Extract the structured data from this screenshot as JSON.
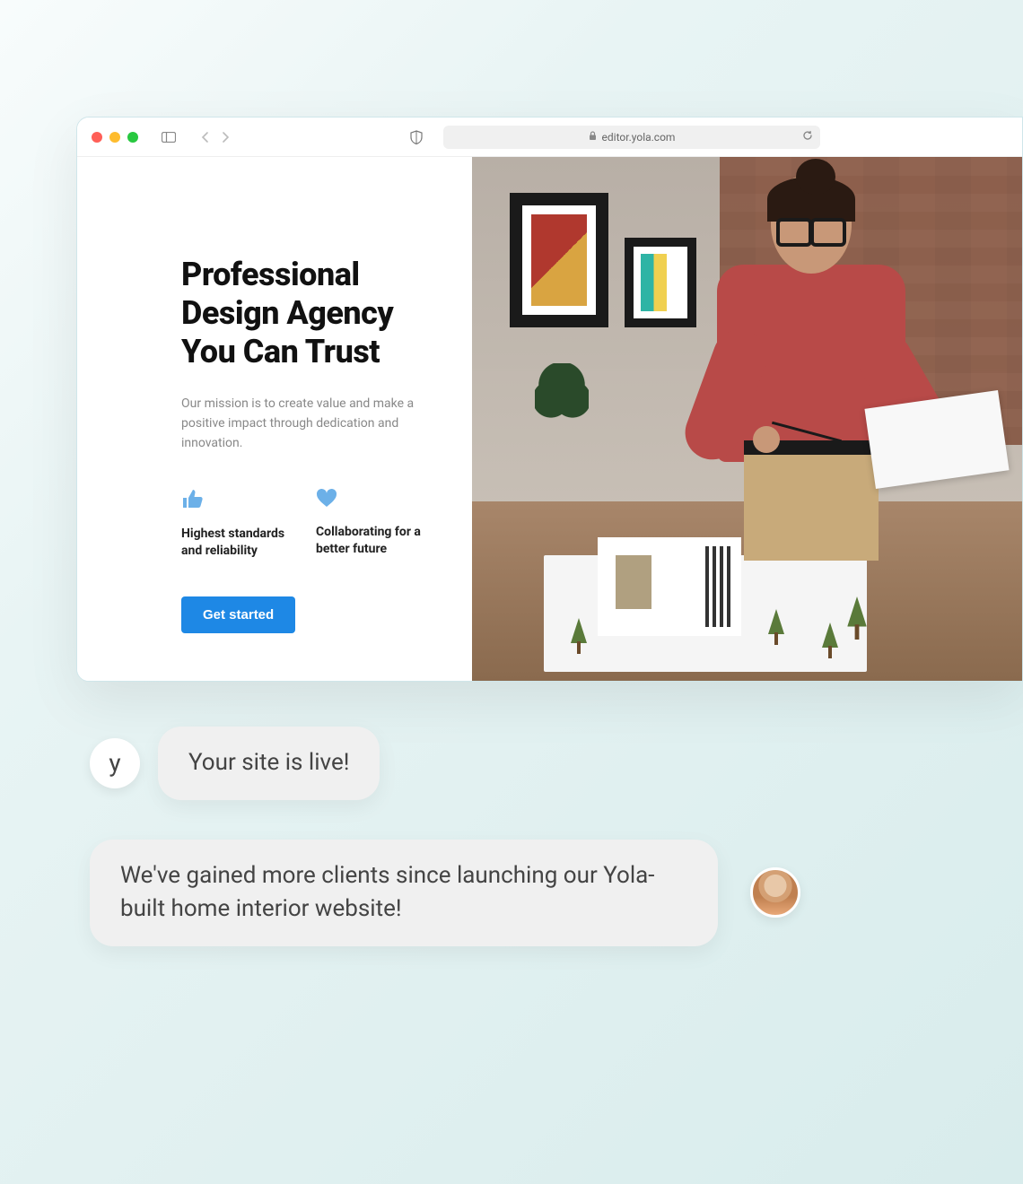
{
  "browser": {
    "url": "editor.yola.com"
  },
  "hero": {
    "heading": "Professional Design Agency You Can Trust",
    "mission": "Our mission is to create value and make a positive impact through dedication and innovation.",
    "features": [
      {
        "icon": "thumbs-up-icon",
        "label": "Highest standards and reliability"
      },
      {
        "icon": "heart-icon",
        "label": "Collaborating for a better future"
      }
    ],
    "cta": "Get started"
  },
  "chat": {
    "bot_avatar_letter": "y",
    "bot_message": "Your site is live!",
    "user_message": "We've gained more clients since launching our Yola-built home interior website!"
  }
}
